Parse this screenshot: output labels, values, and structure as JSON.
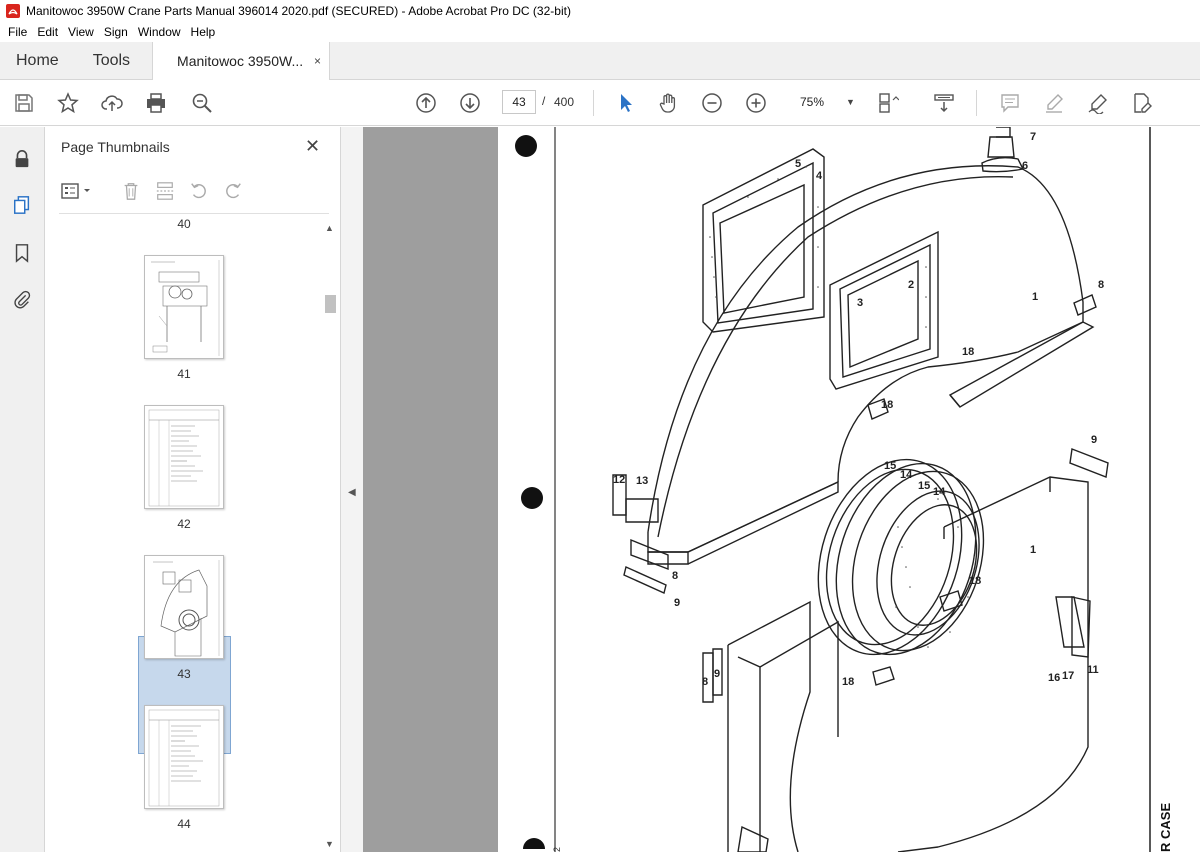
{
  "window": {
    "title": "Manitowoc 3950W Crane Parts Manual 396014 2020.pdf (SECURED) - Adobe Acrobat Pro DC (32-bit)"
  },
  "menu": {
    "items": [
      "File",
      "Edit",
      "View",
      "Sign",
      "Window",
      "Help"
    ]
  },
  "tabs": {
    "home": "Home",
    "tools": "Tools",
    "document": "Manitowoc 3950W...",
    "close": "×"
  },
  "toolbar": {
    "page_current": "43",
    "page_separator": "/",
    "page_total": "400",
    "zoom": "75%"
  },
  "thumbnails": {
    "title": "Page Thumbnails",
    "close": "✕",
    "pages": [
      {
        "label": "40"
      },
      {
        "label": "41"
      },
      {
        "label": "42"
      },
      {
        "label": "43",
        "selected": true
      },
      {
        "label": "44"
      }
    ]
  },
  "drawing": {
    "callouts": [
      "7",
      "6",
      "5",
      "4",
      "3",
      "2",
      "1",
      "8",
      "18",
      "18",
      "9",
      "12",
      "13",
      "15",
      "14",
      "15",
      "14",
      "1",
      "18",
      "8",
      "9",
      "8",
      "9",
      "18",
      "16",
      "17",
      "11"
    ],
    "side_text": "R CASE",
    "margin_mark": "2"
  },
  "colors": {
    "accent": "#2b73c6",
    "doc_background": "#9e9e9e",
    "selection": "#c6d8ec"
  }
}
